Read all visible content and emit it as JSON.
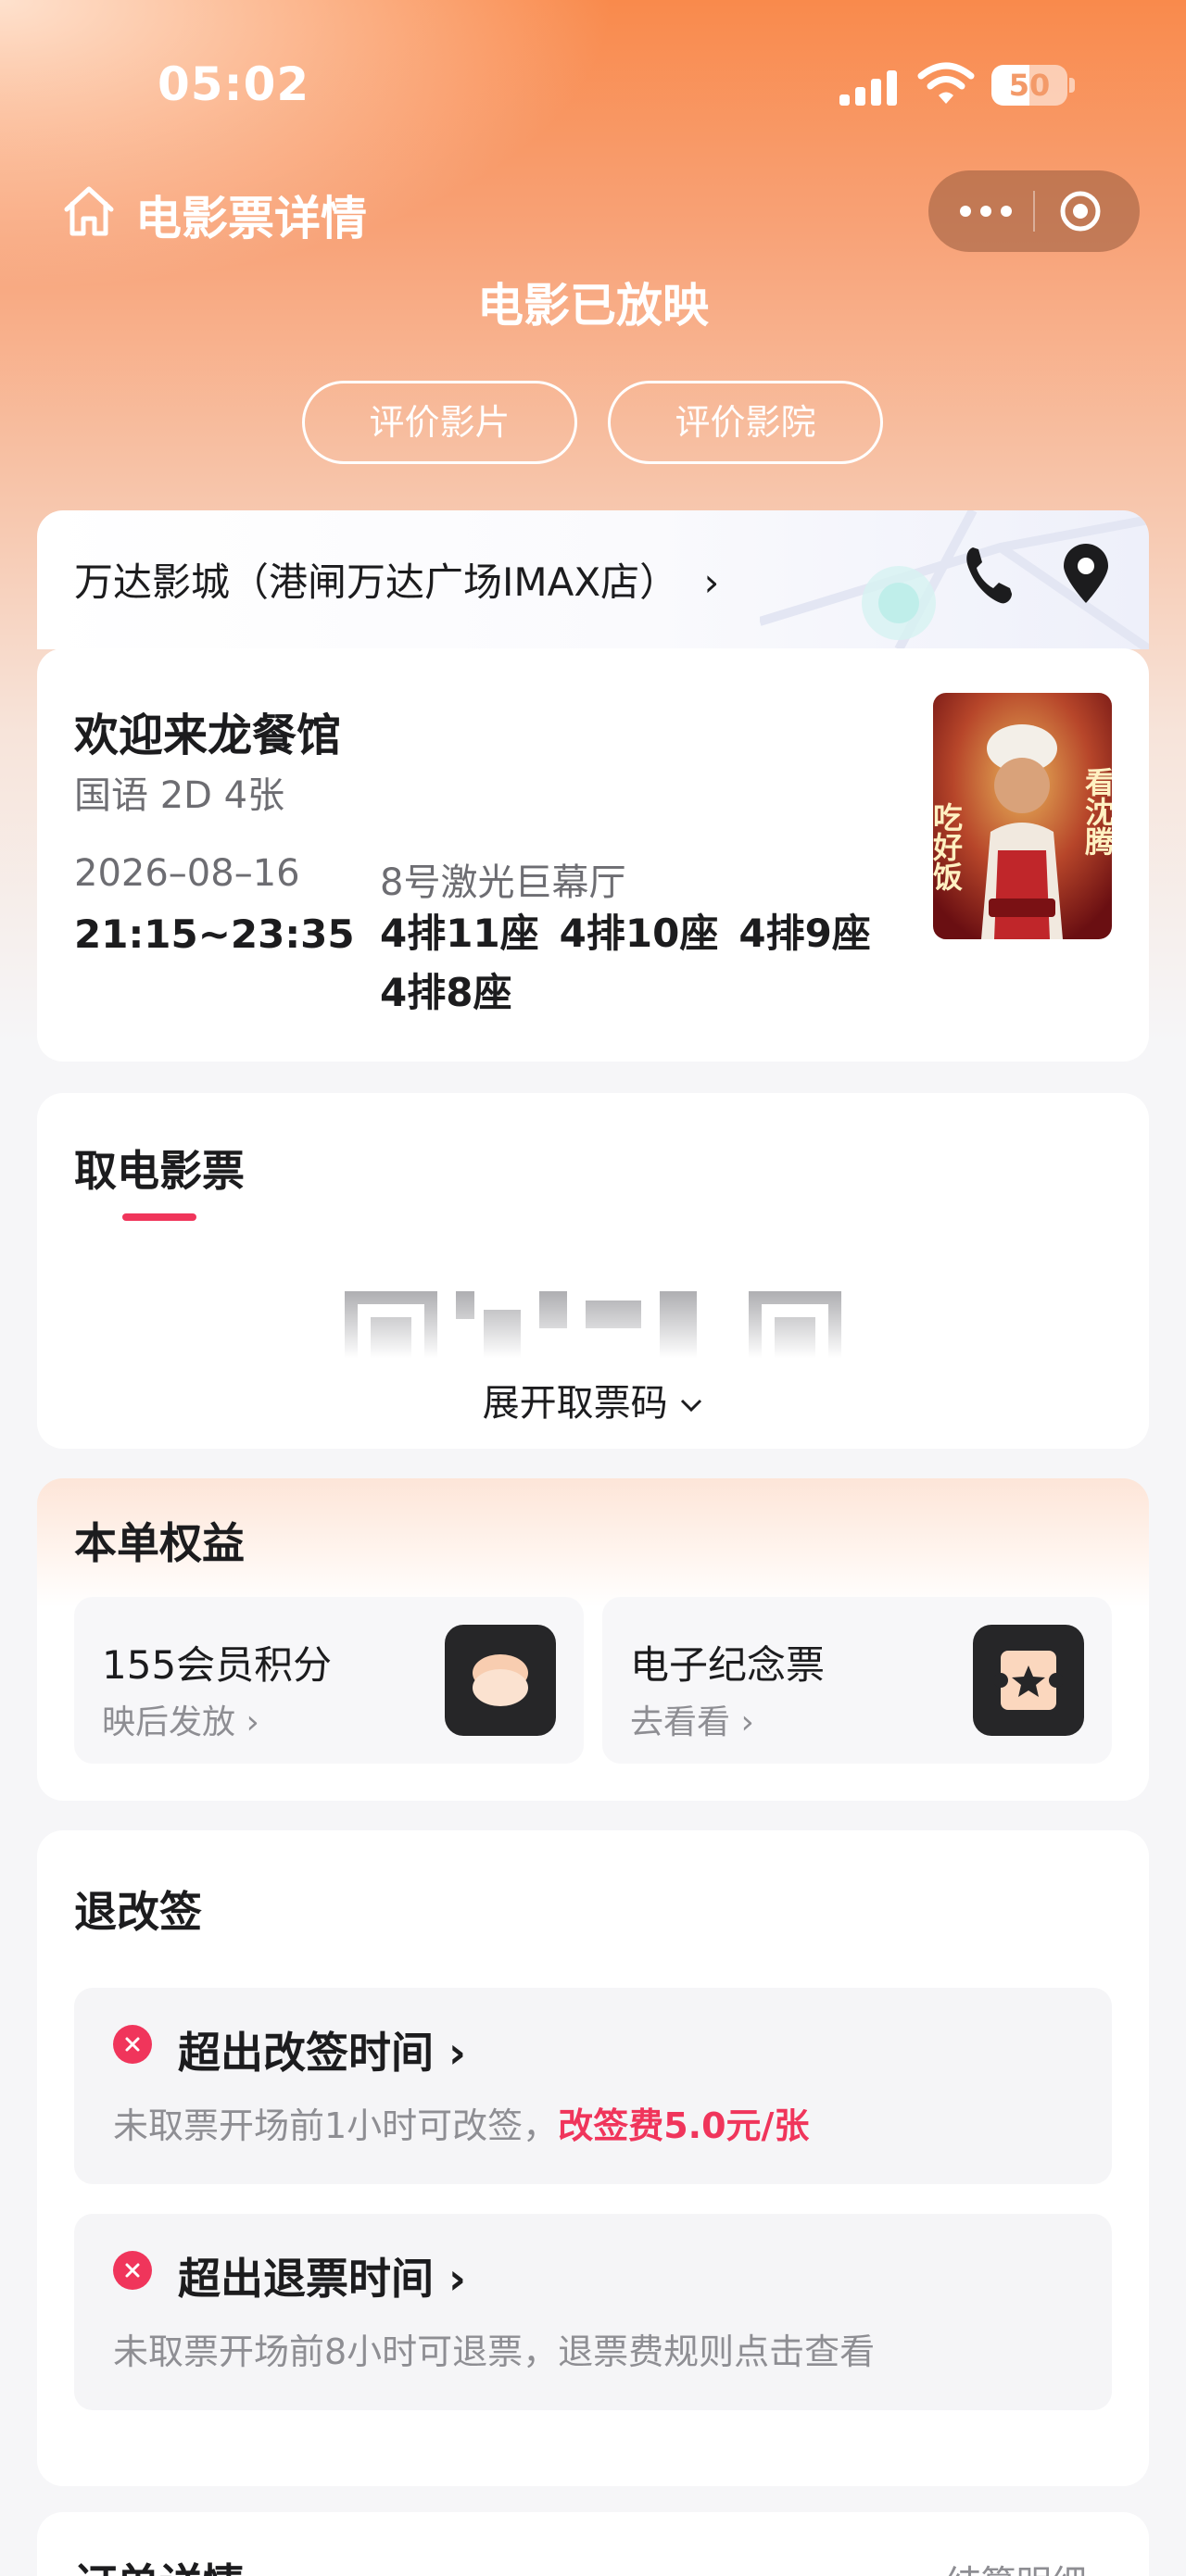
{
  "status_bar": {
    "time": "05:02",
    "battery": "50",
    "battery_level": 0.5
  },
  "nav": {
    "title": "电影票详情"
  },
  "status": {
    "title": "电影已放映",
    "buttons": {
      "rate_film": "评价影片",
      "rate_cinema": "评价影院"
    }
  },
  "cinema": {
    "name": "万达影城（港闸万达广场IMAX店）",
    "chevron": "›"
  },
  "movie": {
    "title": "欢迎来龙餐馆",
    "info": "国语 2D 4张",
    "date": "2026–08–16",
    "time": "21:15~23:35",
    "hall": "8号激光巨幕厅",
    "seats": [
      "4排11座",
      "4排10座",
      "4排9座",
      "4排8座"
    ],
    "poster": {
      "left_text": "吃好饭",
      "right_text": "看沈腾"
    }
  },
  "ticket": {
    "title": "取电影票",
    "expand_label": "展开取票码"
  },
  "benefits": {
    "title": "本单权益",
    "items": [
      {
        "title": "155会员积分",
        "sub": "映后发放",
        "icon": "points-icon"
      },
      {
        "title": "电子纪念票",
        "sub": "去看看",
        "icon": "souvenir-ticket-icon"
      }
    ]
  },
  "refund": {
    "title": "退改签",
    "rules": [
      {
        "title": "超出改签时间",
        "desc": "未取票开场前1小时可改签，",
        "fee": "改签费5.0元/张"
      },
      {
        "title": "超出退票时间",
        "desc": "未取票开场前8小时可退票，退票费规则点击查看",
        "fee": ""
      }
    ]
  },
  "order": {
    "title": "订单详情",
    "link": "结算明细"
  },
  "colors": {
    "accent": "#f0355b",
    "hero_top": "#f98a4c",
    "background": "#f6f6f8"
  }
}
